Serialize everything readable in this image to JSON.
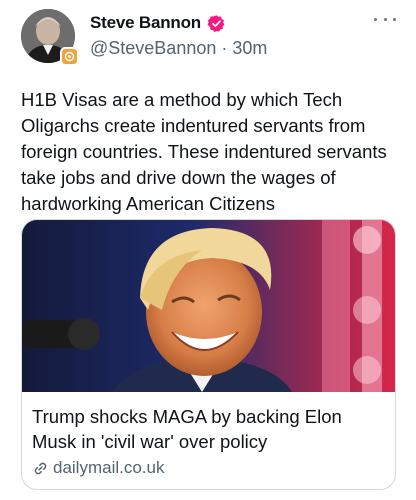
{
  "author": {
    "display_name": "Steve Bannon",
    "handle": "@SteveBannon",
    "time_ago": "30m",
    "separator": "·",
    "verified_color": "#f91880"
  },
  "tweet": {
    "text": "H1B Visas are a method by which Tech\nOligarchs create indentured servants from\nforeign countries. These indentured servants\ntake jobs and drive down the wages of\nhardworking American Citizens"
  },
  "card": {
    "title": "Trump shocks MAGA by backing Elon Musk in 'civil war' over policy",
    "domain": "dailymail.co.uk",
    "image_icon": "photo-of-smiling-man"
  },
  "icons": {
    "more": "more-options-icon",
    "link": "link-icon",
    "verified": "verified-badge-icon",
    "affiliate": "affiliate-badge-icon"
  }
}
